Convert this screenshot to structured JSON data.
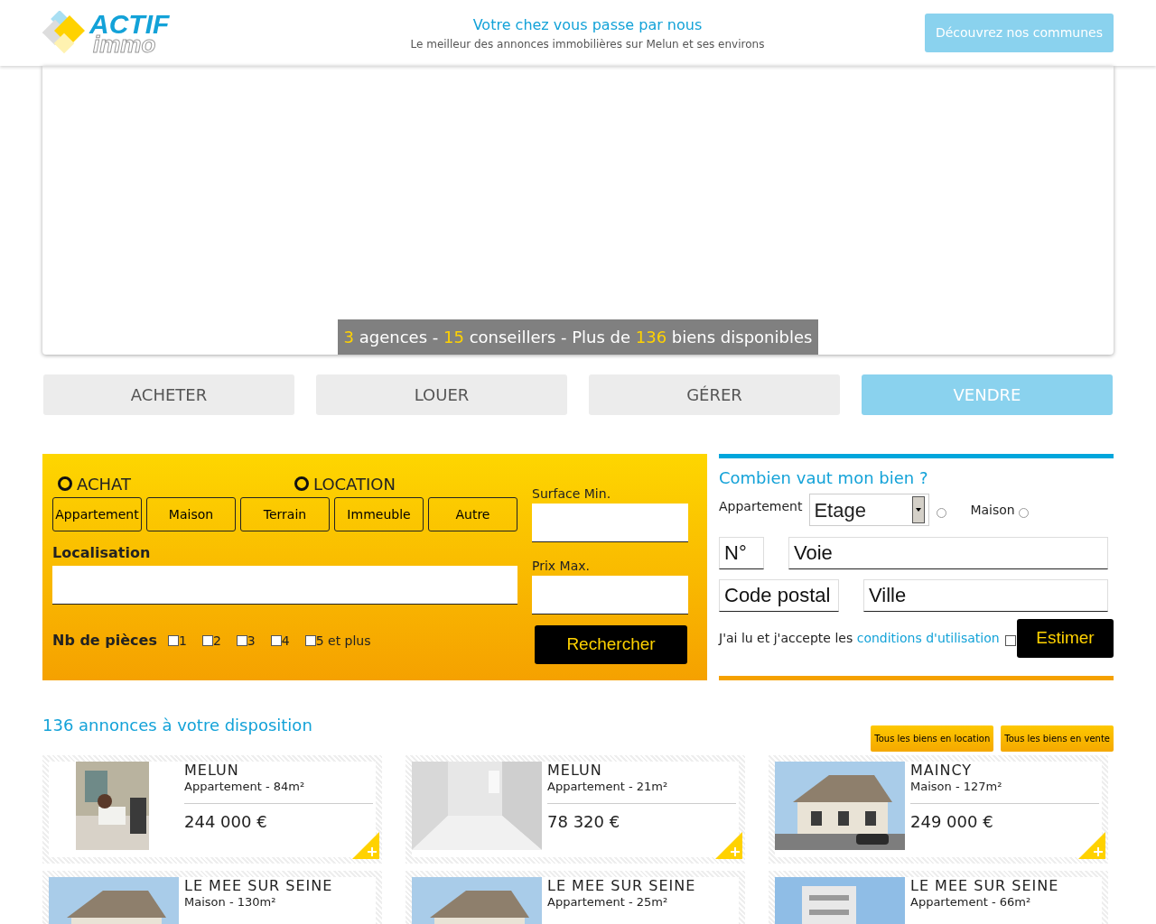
{
  "header": {
    "logo_word_1": "ACTIF",
    "logo_word_2": "immo",
    "title": "Votre chez vous passe par nous",
    "subtitle": "Le meilleur des annonces immobilières sur Melun et ses environs",
    "button": "Découvrez nos communes"
  },
  "stats": [
    {
      "text": "3",
      "highlight": true
    },
    {
      "text": " agences - ",
      "highlight": false
    },
    {
      "text": "15",
      "highlight": true
    },
    {
      "text": " conseillers - Plus de ",
      "highlight": false
    },
    {
      "text": "136",
      "highlight": true
    },
    {
      "text": " biens disponibles",
      "highlight": false
    }
  ],
  "tabs": [
    {
      "label": "ACHETER",
      "selected": false
    },
    {
      "label": "LOUER",
      "selected": false
    },
    {
      "label": "GÉRER",
      "selected": false
    },
    {
      "label": "VENDRE",
      "selected": true
    }
  ],
  "search": {
    "modes": [
      {
        "label": "ACHAT",
        "checked": false
      },
      {
        "label": "LOCATION",
        "checked": false
      }
    ],
    "types": [
      "Appartement",
      "Maison",
      "Terrain",
      "Immeuble",
      "Autre"
    ],
    "location_label": "Localisation",
    "rooms_label": "Nb de pièces",
    "rooms": [
      {
        "label": "1",
        "checked": false
      },
      {
        "label": "2",
        "checked": false
      },
      {
        "label": "3",
        "checked": false
      },
      {
        "label": "4",
        "checked": false
      },
      {
        "label": "5 et plus",
        "checked": false
      }
    ],
    "surface_label": "Surface Min.",
    "price_label": "Prix Max.",
    "button": "Rechercher"
  },
  "estimate": {
    "title": "Combien vaut mon bien ?",
    "apartment_label": "Appartement",
    "floor_select": "Etage",
    "apartment_checked": false,
    "house_label": "Maison",
    "house_checked": false,
    "number_placeholder": "N°",
    "street_placeholder": "Voie",
    "zip_placeholder": "Code postal",
    "city_placeholder": "Ville",
    "terms_text": "J'ai lu et j'accepte les ",
    "terms_link": "conditions d'utilisation",
    "terms_checked": false,
    "button": "Estimer"
  },
  "listings": {
    "title": "136 annonces à votre disposition",
    "buttons": [
      "Tous les biens en location",
      "Tous les biens en vente"
    ],
    "items": [
      {
        "city": "MELUN",
        "detail": "Appartement - 84m²",
        "price": "244 000 €",
        "kind": "portrait"
      },
      {
        "city": "MELUN",
        "detail": "Appartement - 21m²",
        "price": "78 320 €",
        "kind": "room"
      },
      {
        "city": "MAINCY",
        "detail": "Maison - 127m²",
        "price": "249 000 €",
        "kind": "house"
      },
      {
        "city": "LE MEE SUR SEINE",
        "detail": "Maison - 130m²",
        "kind": "house"
      },
      {
        "city": "LE MEE SUR SEINE",
        "detail": "Appartement - 25m²",
        "kind": "house"
      },
      {
        "city": "LE MEE SUR SEINE",
        "detail": "Appartement - 66m²",
        "kind": "tower"
      }
    ]
  }
}
